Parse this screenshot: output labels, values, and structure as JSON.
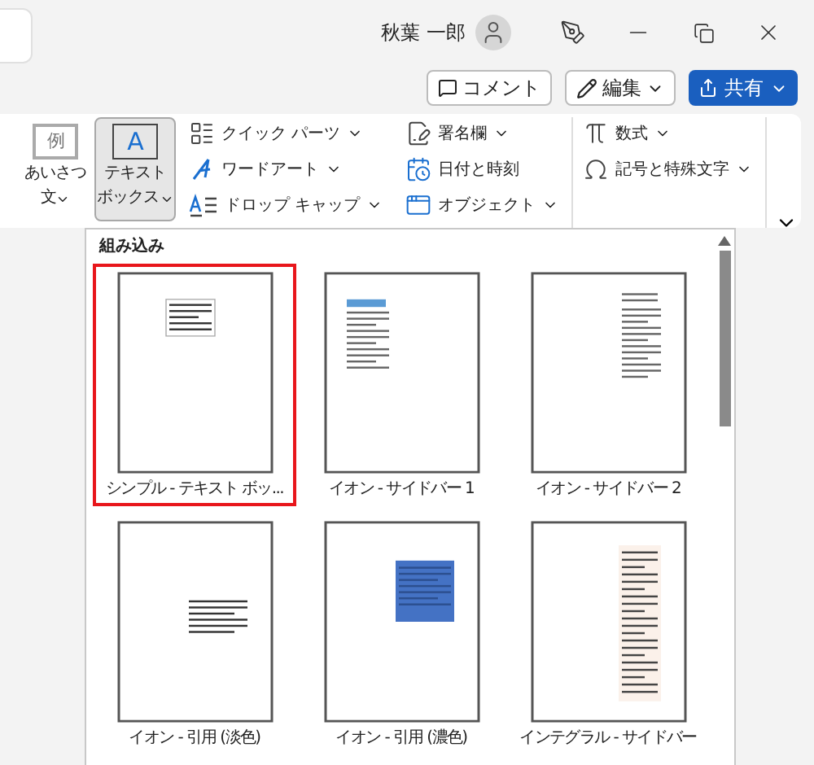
{
  "title_bar": {
    "user_name": "秋葉 一郎"
  },
  "actions": {
    "comment": "コメント",
    "edit": "編集",
    "share": "共有"
  },
  "ribbon": {
    "groups": [
      {
        "kind": "large",
        "items": [
          {
            "lines": [
              "あいさつ",
              "文"
            ],
            "glyph": "例",
            "dropdown": true,
            "selected": false
          },
          {
            "lines": [
              "テキスト",
              "ボックス"
            ],
            "glyph": "A",
            "dropdown": true,
            "selected": true
          }
        ]
      },
      {
        "kind": "small",
        "items": [
          {
            "label": "クイック パーツ",
            "dropdown": true
          },
          {
            "label": "ワードアート",
            "dropdown": true
          },
          {
            "label": "ドロップ キャップ",
            "dropdown": true
          }
        ]
      },
      {
        "kind": "small",
        "items": [
          {
            "label": "署名欄",
            "dropdown": true
          },
          {
            "label": "日付と時刻",
            "dropdown": false
          },
          {
            "label": "オブジェクト",
            "dropdown": true
          }
        ]
      },
      {
        "kind": "small",
        "items": [
          {
            "label": "数式",
            "dropdown": true
          },
          {
            "label": "記号と特殊文字",
            "dropdown": true
          }
        ]
      }
    ]
  },
  "gallery": {
    "heading": "組み込み",
    "items": [
      {
        "label": "シンプル - テキスト ボッ...",
        "kind": "box",
        "selected": true
      },
      {
        "label": "イオン - サイドバー 1",
        "kind": "topbar",
        "selected": false
      },
      {
        "label": "イオン - サイドバー 2",
        "kind": "rightcol",
        "selected": false
      },
      {
        "label": "イオン - 引用 (淡色)",
        "kind": "quote",
        "selected": false
      },
      {
        "label": "イオン - 引用 (濃色)",
        "kind": "dark",
        "selected": false
      },
      {
        "label": "インテグラル - サイドバー",
        "kind": "integral",
        "selected": false
      }
    ]
  }
}
